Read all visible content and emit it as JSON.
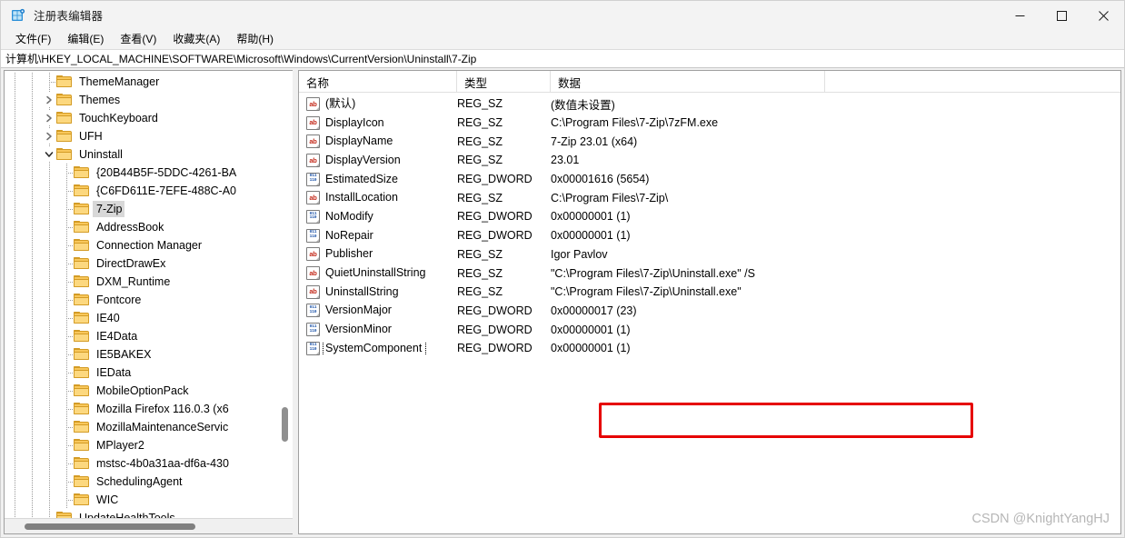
{
  "window": {
    "title": "注册表编辑器",
    "icon": "registry-editor-icon",
    "minimize": "—",
    "maximize": "□",
    "close": "✕"
  },
  "menubar": {
    "items": [
      {
        "label": "文件(F)",
        "name": "menu-file"
      },
      {
        "label": "编辑(E)",
        "name": "menu-edit"
      },
      {
        "label": "查看(V)",
        "name": "menu-view"
      },
      {
        "label": "收藏夹(A)",
        "name": "menu-favorites"
      },
      {
        "label": "帮助(H)",
        "name": "menu-help"
      }
    ]
  },
  "address": {
    "path": "计算机\\HKEY_LOCAL_MACHINE\\SOFTWARE\\Microsoft\\Windows\\CurrentVersion\\Uninstall\\7-Zip"
  },
  "tree": {
    "items": [
      {
        "label": "ThemeManager",
        "depth": 3,
        "twisty": "none",
        "selected": false
      },
      {
        "label": "Themes",
        "depth": 3,
        "twisty": "collapsed",
        "selected": false
      },
      {
        "label": "TouchKeyboard",
        "depth": 3,
        "twisty": "collapsed",
        "selected": false
      },
      {
        "label": "UFH",
        "depth": 3,
        "twisty": "collapsed",
        "selected": false
      },
      {
        "label": "Uninstall",
        "depth": 3,
        "twisty": "expanded",
        "selected": false
      },
      {
        "label": "{20B44B5F-5DDC-4261-BA",
        "depth": 4,
        "twisty": "none",
        "selected": false
      },
      {
        "label": "{C6FD611E-7EFE-488C-A0",
        "depth": 4,
        "twisty": "none",
        "selected": false
      },
      {
        "label": "7-Zip",
        "depth": 4,
        "twisty": "none",
        "selected": true
      },
      {
        "label": "AddressBook",
        "depth": 4,
        "twisty": "none",
        "selected": false
      },
      {
        "label": "Connection Manager",
        "depth": 4,
        "twisty": "none",
        "selected": false
      },
      {
        "label": "DirectDrawEx",
        "depth": 4,
        "twisty": "none",
        "selected": false
      },
      {
        "label": "DXM_Runtime",
        "depth": 4,
        "twisty": "none",
        "selected": false
      },
      {
        "label": "Fontcore",
        "depth": 4,
        "twisty": "none",
        "selected": false
      },
      {
        "label": "IE40",
        "depth": 4,
        "twisty": "none",
        "selected": false
      },
      {
        "label": "IE4Data",
        "depth": 4,
        "twisty": "none",
        "selected": false
      },
      {
        "label": "IE5BAKEX",
        "depth": 4,
        "twisty": "none",
        "selected": false
      },
      {
        "label": "IEData",
        "depth": 4,
        "twisty": "none",
        "selected": false
      },
      {
        "label": "MobileOptionPack",
        "depth": 4,
        "twisty": "none",
        "selected": false
      },
      {
        "label": "Mozilla Firefox 116.0.3 (x6",
        "depth": 4,
        "twisty": "none",
        "selected": false
      },
      {
        "label": "MozillaMaintenanceServic",
        "depth": 4,
        "twisty": "none",
        "selected": false
      },
      {
        "label": "MPlayer2",
        "depth": 4,
        "twisty": "none",
        "selected": false
      },
      {
        "label": "mstsc-4b0a31aa-df6a-430",
        "depth": 4,
        "twisty": "none",
        "selected": false
      },
      {
        "label": "SchedulingAgent",
        "depth": 4,
        "twisty": "none",
        "selected": false
      },
      {
        "label": "WIC",
        "depth": 4,
        "twisty": "none",
        "selected": false
      },
      {
        "label": "UpdateHealthTools",
        "depth": 3,
        "twisty": "none",
        "selected": false
      }
    ]
  },
  "list": {
    "columns": [
      {
        "label": "名称",
        "name": "column-name"
      },
      {
        "label": "类型",
        "name": "column-type"
      },
      {
        "label": "数据",
        "name": "column-data"
      }
    ],
    "rows": [
      {
        "name": "(默认)",
        "type": "REG_SZ",
        "data": "(数值未设置)",
        "icon": "reg-sz-icon",
        "focused": false
      },
      {
        "name": "DisplayIcon",
        "type": "REG_SZ",
        "data": "C:\\Program Files\\7-Zip\\7zFM.exe",
        "icon": "reg-sz-icon",
        "focused": false
      },
      {
        "name": "DisplayName",
        "type": "REG_SZ",
        "data": "7-Zip 23.01 (x64)",
        "icon": "reg-sz-icon",
        "focused": false
      },
      {
        "name": "DisplayVersion",
        "type": "REG_SZ",
        "data": "23.01",
        "icon": "reg-sz-icon",
        "focused": false
      },
      {
        "name": "EstimatedSize",
        "type": "REG_DWORD",
        "data": "0x00001616 (5654)",
        "icon": "reg-dword-icon",
        "focused": false
      },
      {
        "name": "InstallLocation",
        "type": "REG_SZ",
        "data": "C:\\Program Files\\7-Zip\\",
        "icon": "reg-sz-icon",
        "focused": false
      },
      {
        "name": "NoModify",
        "type": "REG_DWORD",
        "data": "0x00000001 (1)",
        "icon": "reg-dword-icon",
        "focused": false
      },
      {
        "name": "NoRepair",
        "type": "REG_DWORD",
        "data": "0x00000001 (1)",
        "icon": "reg-dword-icon",
        "focused": false
      },
      {
        "name": "Publisher",
        "type": "REG_SZ",
        "data": "Igor Pavlov",
        "icon": "reg-sz-icon",
        "focused": false
      },
      {
        "name": "QuietUninstallString",
        "type": "REG_SZ",
        "data": "\"C:\\Program Files\\7-Zip\\Uninstall.exe\" /S",
        "icon": "reg-sz-icon",
        "focused": false
      },
      {
        "name": "UninstallString",
        "type": "REG_SZ",
        "data": "\"C:\\Program Files\\7-Zip\\Uninstall.exe\"",
        "icon": "reg-sz-icon",
        "focused": false
      },
      {
        "name": "VersionMajor",
        "type": "REG_DWORD",
        "data": "0x00000017 (23)",
        "icon": "reg-dword-icon",
        "focused": false
      },
      {
        "name": "VersionMinor",
        "type": "REG_DWORD",
        "data": "0x00000001 (1)",
        "icon": "reg-dword-icon",
        "focused": false
      },
      {
        "name": "SystemComponent",
        "type": "REG_DWORD",
        "data": "0x00000001 (1)",
        "icon": "reg-dword-icon",
        "focused": true
      }
    ]
  },
  "annotation": {
    "highlight_color": "#e60000",
    "highlighted_row": "SystemComponent"
  },
  "watermark": {
    "text": "CSDN @KnightYangHJ"
  }
}
